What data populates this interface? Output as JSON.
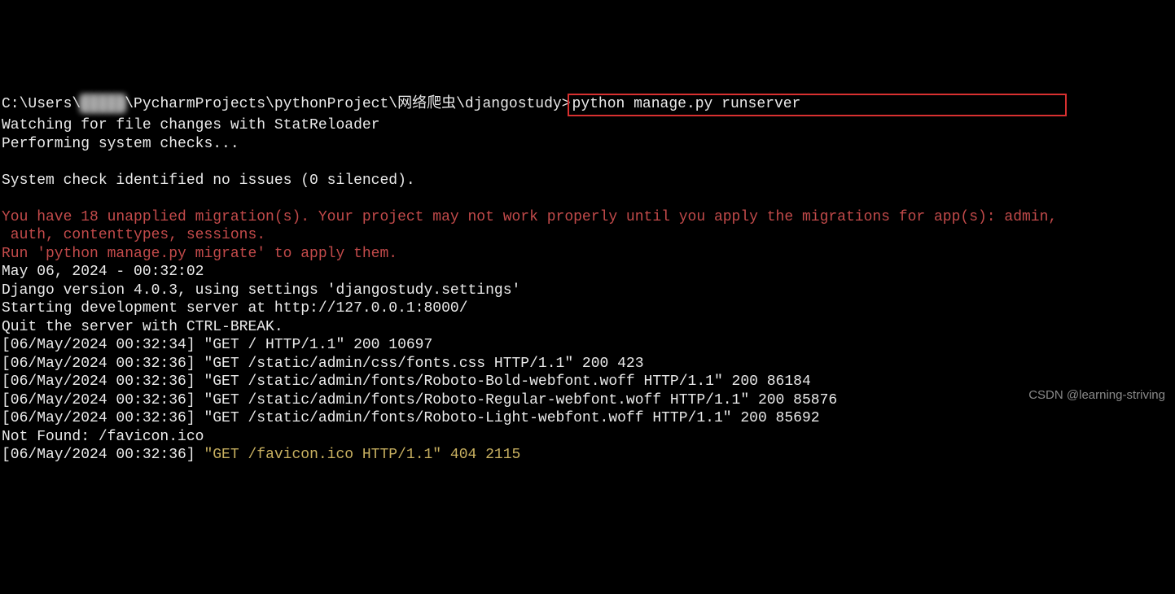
{
  "prompt": {
    "path_prefix": "C:\\Users\\",
    "redacted_user": "█████",
    "path_suffix": "\\PycharmProjects\\pythonProject\\网络爬虫\\djangostudy>",
    "command": "python manage.py runserver"
  },
  "lines": {
    "watching": "Watching for file changes with StatReloader",
    "performing": "Performing system checks...",
    "blank1": "",
    "syscheck": "System check identified no issues (0 silenced).",
    "blank2": "",
    "warn1": "You have 18 unapplied migration(s). Your project may not work properly until you apply the migrations for app(s): admin,",
    "warn2": " auth, contenttypes, sessions.",
    "warn3": "Run 'python manage.py migrate' to apply them.",
    "timestamp": "May 06, 2024 - 00:32:02",
    "version": "Django version 4.0.3, using settings 'djangostudy.settings'",
    "starting": "Starting development server at http://127.0.0.1:8000/",
    "quit": "Quit the server with CTRL-BREAK.",
    "req1": "[06/May/2024 00:32:34] \"GET / HTTP/1.1\" 200 10697",
    "req2": "[06/May/2024 00:32:36] \"GET /static/admin/css/fonts.css HTTP/1.1\" 200 423",
    "req3": "[06/May/2024 00:32:36] \"GET /static/admin/fonts/Roboto-Bold-webfont.woff HTTP/1.1\" 200 86184",
    "req4": "[06/May/2024 00:32:36] \"GET /static/admin/fonts/Roboto-Regular-webfont.woff HTTP/1.1\" 200 85876",
    "req5": "[06/May/2024 00:32:36] \"GET /static/admin/fonts/Roboto-Light-webfont.woff HTTP/1.1\" 200 85692",
    "notfound": "Not Found: /favicon.ico",
    "req6_prefix": "[06/May/2024 00:32:36] ",
    "req6_yellow": "\"GET /favicon.ico HTTP/1.1\" 404 2115"
  },
  "watermark": "CSDN @learning-striving"
}
